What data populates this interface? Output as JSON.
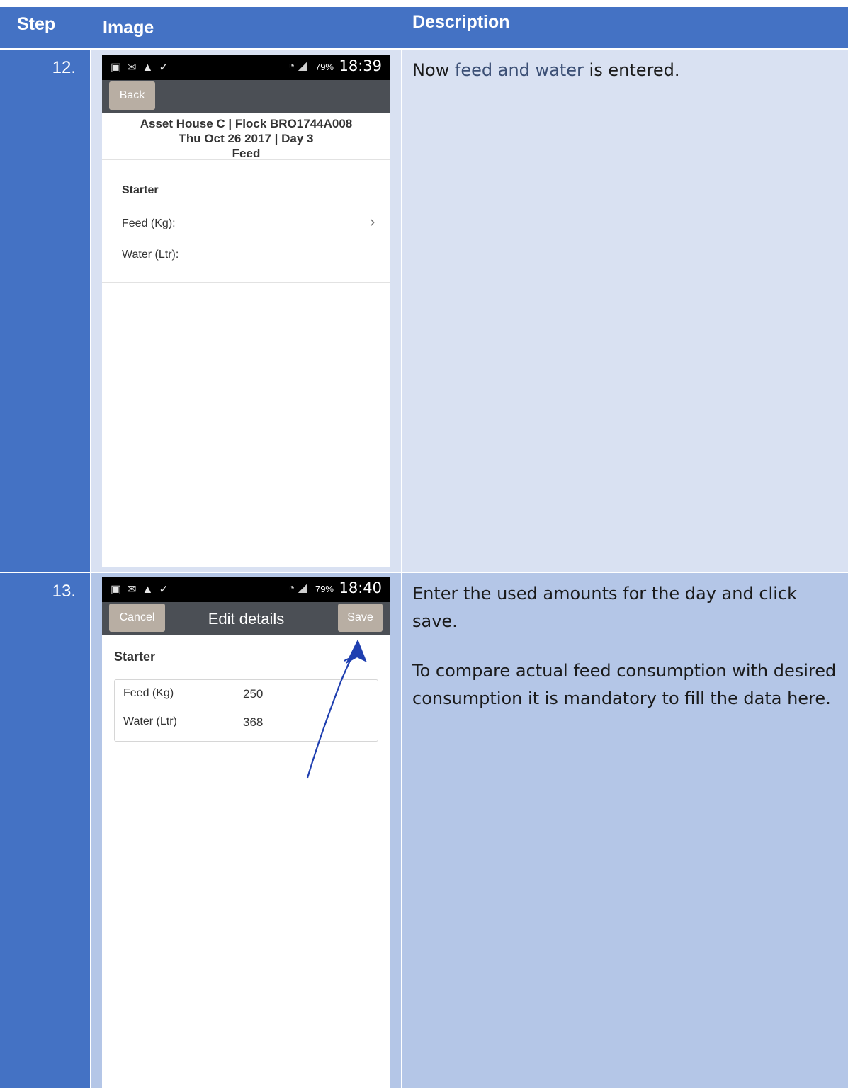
{
  "table": {
    "headers": {
      "step": "Step",
      "image": "Image",
      "description": "Description"
    },
    "rows": [
      {
        "step": "12.",
        "description_parts": {
          "before": "Now ",
          "highlight": "feed and water",
          "after": " is entered."
        },
        "screen": {
          "status_time": "18:39",
          "status_battery": "79%",
          "back_label": "Back",
          "header_line1": "Asset House C | Flock BRO1744A008",
          "header_line2": "Thu Oct 26 2017 | Day 3",
          "header_line3": "Feed",
          "section": "Starter",
          "feed_label": "Feed (Kg):",
          "water_label": "Water (Ltr):"
        }
      },
      {
        "step": "13.",
        "description_p1": "Enter the used amounts for the day and click save.",
        "description_p2": "To compare actual feed consumption with desired consumption it is mandatory to fill the data here.",
        "screen": {
          "status_time": "18:40",
          "status_battery": "79%",
          "cancel_label": "Cancel",
          "title": "Edit details",
          "save_label": "Save",
          "section": "Starter",
          "fields": [
            {
              "label": "Feed (Kg)",
              "value": "250"
            },
            {
              "label": "Water (Ltr)",
              "value": "368"
            }
          ]
        }
      }
    ]
  },
  "colors": {
    "header": "#4472c4",
    "row1": "#d9e1f2",
    "row2": "#b4c6e7",
    "annotation": "#1f3fb0"
  },
  "icons": {
    "status_left": [
      "notification-icon",
      "mail-icon",
      "flag-icon",
      "check-icon"
    ],
    "status_right": [
      "signal-icon",
      "wifi-icon",
      "battery-icon"
    ],
    "chevron": "chevron-right-icon",
    "arrow": "annotation-arrow-icon"
  }
}
